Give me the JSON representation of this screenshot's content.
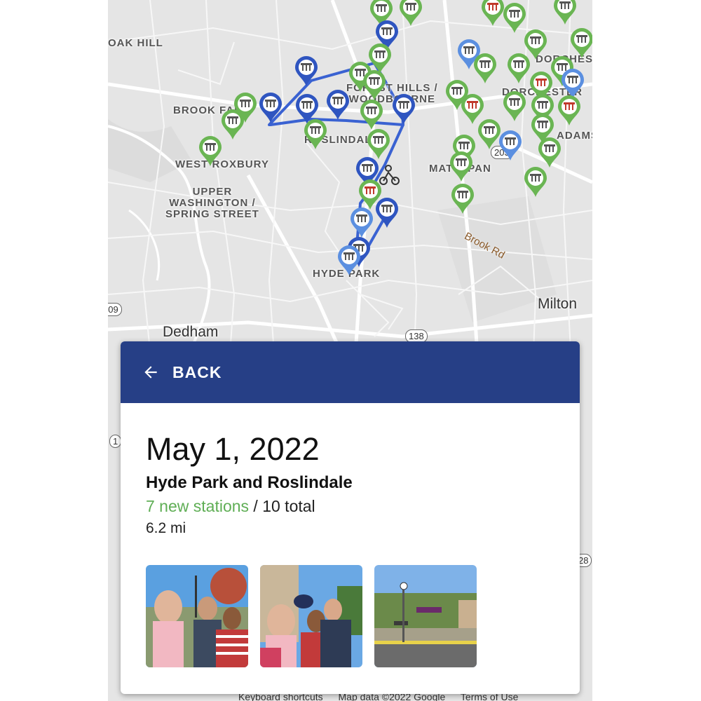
{
  "map": {
    "places": [
      "OAK HILL",
      "BROOK FARM",
      "WEST ROXBURY",
      "UPPER\nWASHINGTON /\nSPRING STREET",
      "FOREST HILLS /\nWOODBOURNE",
      "ROSLINDALE",
      "MATTAPAN",
      "HYDE PARK",
      "DORCHESTER",
      "DORCHESTER",
      "ADAMS"
    ],
    "cities": [
      "Dedham",
      "Milton"
    ],
    "road": "Brook Rd",
    "shields": [
      "109",
      "138",
      "203",
      "28",
      "1"
    ],
    "route_color": "#3a62d2",
    "marker_colors": {
      "visited_green": "#6ab553",
      "route_blue": "#2f55c0",
      "light_blue": "#5b8fe0",
      "icon_red": "#c0392b"
    },
    "footer": [
      "Keyboard shortcuts",
      "Map data ©2022 Google",
      "Terms of Use"
    ]
  },
  "card": {
    "back_label": "BACK",
    "back_icon": "arrow-left-icon",
    "date": "May 1, 2022",
    "title": "Hyde Park and Roslindale",
    "new_stations": "7 new stations",
    "separator": " / ",
    "total": "10 total",
    "distance": "6.2 mi",
    "photos": [
      "photo-1",
      "photo-2",
      "photo-3"
    ]
  },
  "colors": {
    "header": "#263f86",
    "new_green": "#5fae55"
  }
}
